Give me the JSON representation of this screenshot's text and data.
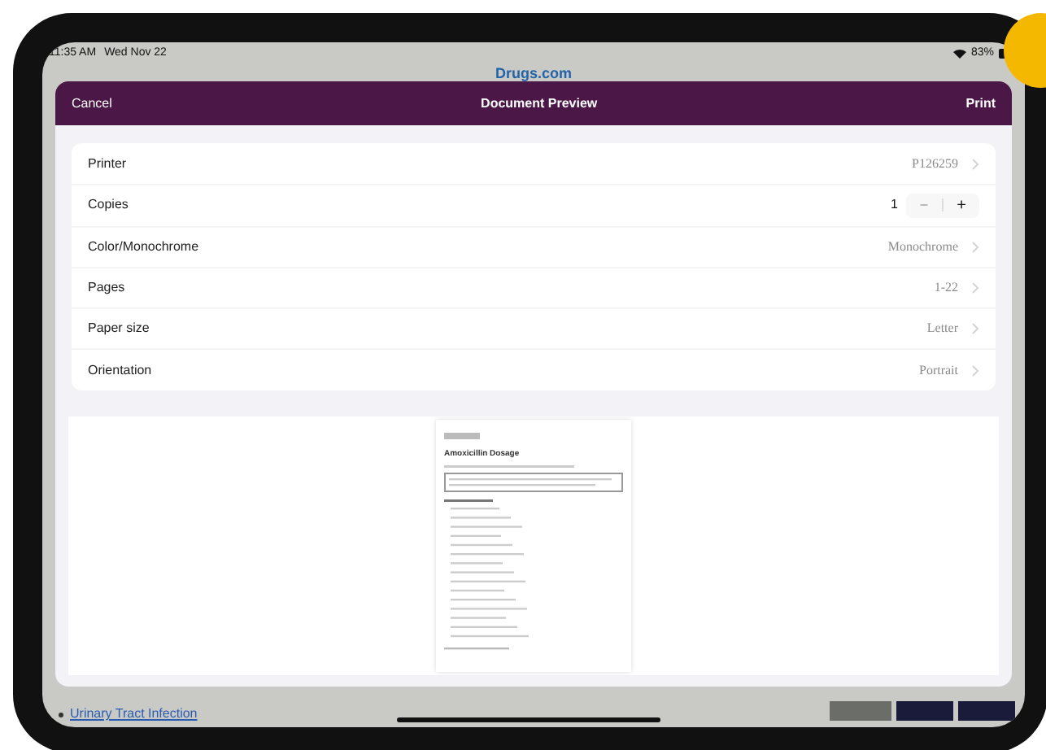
{
  "status_bar": {
    "time": "11:35 AM",
    "date": "Wed Nov 22",
    "battery": "83%"
  },
  "background_page": {
    "logo": "Drugs.com",
    "link": "Urinary Tract Infection"
  },
  "sheet": {
    "cancel": "Cancel",
    "title": "Document Preview",
    "print": "Print",
    "settings": [
      {
        "kind": "value",
        "label": "Printer",
        "value": "P126259"
      },
      {
        "kind": "stepper",
        "label": "Copies",
        "value": "1",
        "minus": "−",
        "plus": "+"
      },
      {
        "kind": "value",
        "label": "Color/Monochrome",
        "value": "Monochrome"
      },
      {
        "kind": "value",
        "label": "Pages",
        "value": "1-22"
      },
      {
        "kind": "value",
        "label": "Paper size",
        "value": "Letter"
      },
      {
        "kind": "value",
        "label": "Orientation",
        "value": "Portrait"
      }
    ],
    "preview": {
      "title": "Amoxicillin Dosage"
    }
  }
}
